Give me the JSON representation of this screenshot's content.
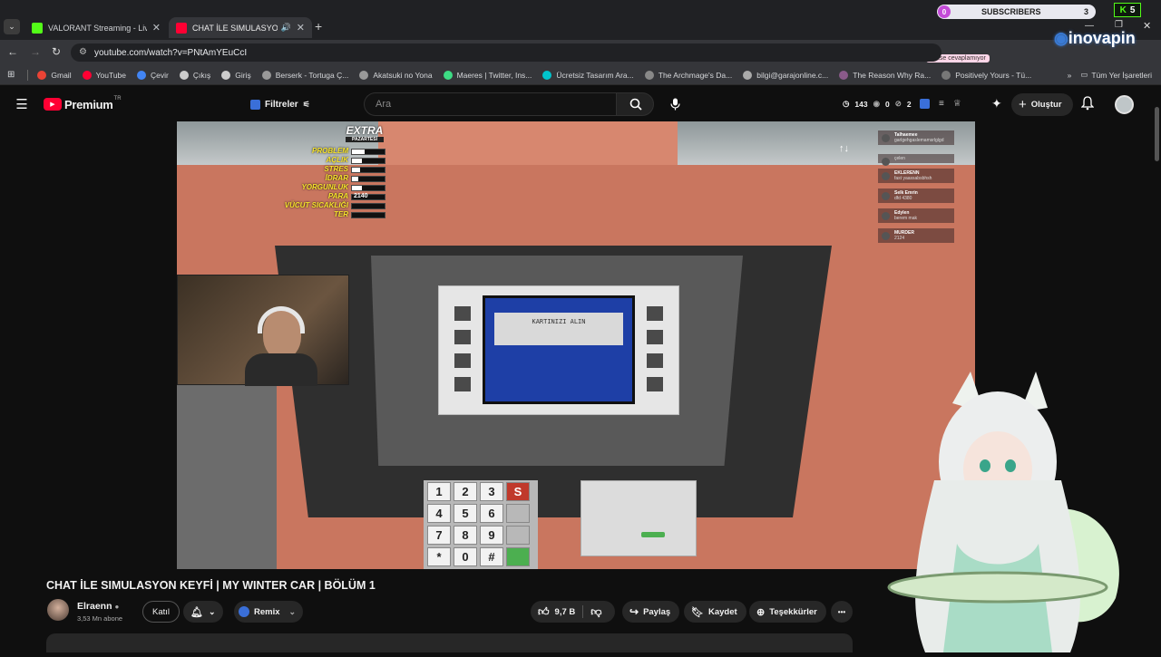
{
  "browser": {
    "tabs": [
      {
        "label": "VALORANT Streaming - Live Str",
        "active": false,
        "favicon_color": "#53fc18"
      },
      {
        "label": "CHAT İLE SIMULASYON KEYF",
        "active": true,
        "favicon_color": "#ff0033"
      }
    ],
    "new_tab_symbol": "+",
    "url": "youtube.com/watch?v=PNtAmYEuCcI",
    "bookmarks": [
      {
        "label": "Gmail",
        "color": "#ea4335"
      },
      {
        "label": "YouTube",
        "color": "#ff0033"
      },
      {
        "label": "Çevir",
        "color": "#4285f4"
      },
      {
        "label": "Çıkış",
        "color": "#cccccc"
      },
      {
        "label": "Giriş",
        "color": "#cccccc"
      },
      {
        "label": "Berserk - Tortuga Ç...",
        "color": "#999999"
      },
      {
        "label": "Akatsuki no Yona",
        "color": "#999999"
      },
      {
        "label": "Maeres | Twitter, Ins...",
        "color": "#3ddc84"
      },
      {
        "label": "Ücretsiz Tasarım Ara...",
        "color": "#00c4cc"
      },
      {
        "label": "The Archmage's Da...",
        "color": "#888888"
      },
      {
        "label": "bilgi@garajonline.c...",
        "color": "#aaaaaa"
      },
      {
        "label": "The Reason Why Ra...",
        "color": "#8a5a8a"
      },
      {
        "label": "Positively Yours - Tü...",
        "color": "#777777"
      }
    ],
    "all_bookmarks": "Tüm Yer İşaretleri",
    "subscribers_widget": {
      "left_count": "0",
      "label": "SUBSCRIBERS",
      "right_count": "3",
      "k_count": "5"
    },
    "inovapin_logo": "inovapin",
    "extension_note": "kimse cevaplamıyor"
  },
  "youtube": {
    "logo": "Premium",
    "logo_region": "TR",
    "filters_label": "Filtreler",
    "search_placeholder": "Ara",
    "stats": {
      "views": "143",
      "a": "0",
      "b": "2"
    },
    "create_label": "Oluştur",
    "video_title": "CHAT İLE SIMULASYON KEYFİ | MY WINTER CAR | BÖLÜM 1",
    "channel_name": "Elraenn",
    "subscribers": "3,53 Mn abone",
    "join_label": "Katıl",
    "remix_label": "Remix",
    "likes": "9,7 B",
    "share_label": "Paylaş",
    "save_label": "Kaydet",
    "thanks_label": "Teşekkürler",
    "more_symbol": "•••"
  },
  "game": {
    "stats_header": "EXTRA",
    "stats_sub": "PAZARTESİ",
    "stats": [
      {
        "label": "PROBLEM",
        "fill": 0.4
      },
      {
        "label": "AÇLIK",
        "fill": 0.3
      },
      {
        "label": "STRES",
        "fill": 0.25
      },
      {
        "label": "İDRAR",
        "fill": 0.2
      },
      {
        "label": "YORGUNLUK",
        "fill": 0.3
      },
      {
        "label": "PARA",
        "value": "2140"
      },
      {
        "label": "VÜCUT SICAKLIĞI",
        "fill": 0
      },
      {
        "label": "TER",
        "fill": 0
      }
    ],
    "atm_screen_text": "KARTINIZI ALIN",
    "keypad": [
      "1",
      "2",
      "3",
      "S",
      "4",
      "5",
      "6",
      "",
      "7",
      "8",
      "9",
      "",
      "*",
      "0",
      "#",
      ""
    ],
    "chat": [
      {
        "name": "Talhaemee",
        "msg": "garlgehgaslemamsrlglgd"
      },
      {
        "name": "",
        "msg": "çelen"
      },
      {
        "name": "EKLERENN",
        "msg": "fast yaassabsbhsh"
      },
      {
        "name": "Selk Emrin",
        "msg": "dfd 4380"
      },
      {
        "name": "Edylen",
        "msg": "berem mak"
      },
      {
        "name": "MURDER",
        "msg": "2124"
      }
    ]
  }
}
